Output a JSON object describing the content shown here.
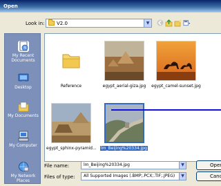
{
  "window": {
    "title": "Open"
  },
  "lookin": {
    "label": "Look in:",
    "value": "V2.0"
  },
  "places": [
    {
      "label": "My Recent Documents",
      "icon": "recent-documents-icon"
    },
    {
      "label": "Desktop",
      "icon": "desktop-icon"
    },
    {
      "label": "My Documents",
      "icon": "my-documents-icon"
    },
    {
      "label": "My Computer",
      "icon": "my-computer-icon"
    },
    {
      "label": "My Network Places",
      "icon": "network-places-icon"
    }
  ],
  "files": [
    {
      "name": "Reference",
      "type": "folder"
    },
    {
      "name": "egypt_aerial-giza.jpg",
      "type": "image"
    },
    {
      "name": "egypt_camel-sunset.jpg",
      "type": "image"
    },
    {
      "name": "egypt_sphinx-pyramid...",
      "type": "image"
    },
    {
      "name": "lm_Beijing%20334.jpg",
      "type": "image",
      "selected": true
    }
  ],
  "filename": {
    "label": "File name:",
    "value": "lm_Beijing%20334.jpg"
  },
  "filetype": {
    "label": "Files of type:",
    "value": "All Supported Images (.BMP;.PCX;.TIF;.JPEG)"
  },
  "buttons": {
    "open": "Open",
    "cancel": "Cancel"
  },
  "colors": {
    "selection": "#316ac5",
    "places_bg": "#7c90ba",
    "marker": "#1010e0"
  }
}
